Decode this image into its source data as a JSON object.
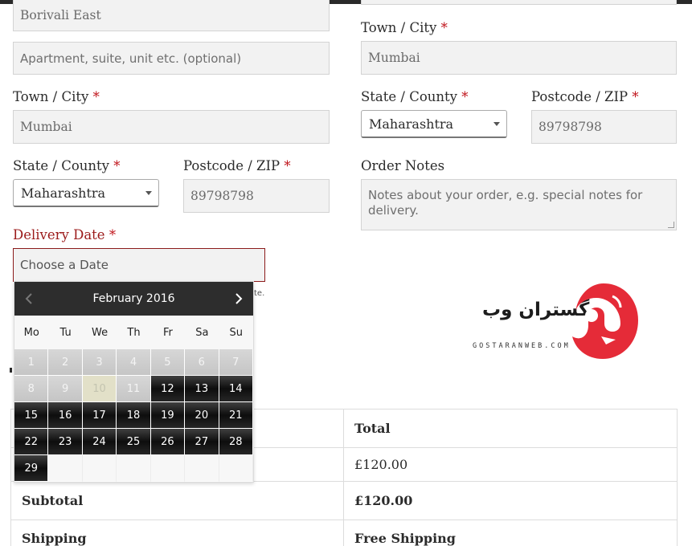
{
  "billing": {
    "address_1": "Borivali East",
    "address_2_placeholder": "Apartment, suite, unit etc. (optional)",
    "city_label": "Town / City",
    "city_value": "Mumbai",
    "state_label": "State / County",
    "state_value": "Maharashtra",
    "postcode_label": "Postcode / ZIP",
    "postcode_value": "89798798",
    "required_mark": "*"
  },
  "shipping": {
    "city_label": "Town / City",
    "city_value": "Mumbai",
    "state_label": "State / County",
    "state_value": "Maharashtra",
    "postcode_label": "Postcode / ZIP",
    "postcode_value": "89798798",
    "order_notes_label": "Order Notes",
    "order_notes_placeholder": "Notes about your order, e.g. special notes for delivery."
  },
  "delivery": {
    "label": "Delivery Date",
    "placeholder": "Choose a Date",
    "hint_fragment": "te."
  },
  "calendar": {
    "month_label": "February 2016",
    "weekdays": [
      "Mo",
      "Tu",
      "We",
      "Th",
      "Fr",
      "Sa",
      "Su"
    ],
    "days": [
      {
        "n": "1",
        "state": "past"
      },
      {
        "n": "2",
        "state": "past"
      },
      {
        "n": "3",
        "state": "past"
      },
      {
        "n": "4",
        "state": "past"
      },
      {
        "n": "5",
        "state": "past"
      },
      {
        "n": "6",
        "state": "past"
      },
      {
        "n": "7",
        "state": "past"
      },
      {
        "n": "8",
        "state": "past"
      },
      {
        "n": "9",
        "state": "past"
      },
      {
        "n": "10",
        "state": "today"
      },
      {
        "n": "11",
        "state": "past"
      },
      {
        "n": "12",
        "state": "avail"
      },
      {
        "n": "13",
        "state": "avail"
      },
      {
        "n": "14",
        "state": "avail"
      },
      {
        "n": "15",
        "state": "avail"
      },
      {
        "n": "16",
        "state": "avail"
      },
      {
        "n": "17",
        "state": "avail"
      },
      {
        "n": "18",
        "state": "avail"
      },
      {
        "n": "19",
        "state": "avail"
      },
      {
        "n": "20",
        "state": "avail"
      },
      {
        "n": "21",
        "state": "avail"
      },
      {
        "n": "22",
        "state": "avail"
      },
      {
        "n": "23",
        "state": "avail"
      },
      {
        "n": "24",
        "state": "avail"
      },
      {
        "n": "25",
        "state": "avail"
      },
      {
        "n": "26",
        "state": "avail"
      },
      {
        "n": "27",
        "state": "avail"
      },
      {
        "n": "28",
        "state": "avail"
      },
      {
        "n": "29",
        "state": "avail"
      },
      {
        "n": "",
        "state": "empty"
      },
      {
        "n": "",
        "state": "empty"
      },
      {
        "n": "",
        "state": "empty"
      },
      {
        "n": "",
        "state": "empty"
      },
      {
        "n": "",
        "state": "empty"
      },
      {
        "n": "",
        "state": "empty"
      }
    ],
    "prev_icon": "chevron-left-icon",
    "next_icon": "chevron-right-icon"
  },
  "order": {
    "total_header": "Total",
    "product_total": "£120.00",
    "subtotal_label": "Subtotal",
    "subtotal_value": "£120.00",
    "shipping_label": "Shipping",
    "shipping_value": "Free Shipping"
  },
  "logo": {
    "text": "گستران وب",
    "domain": "GOSTARANWEB.COM"
  },
  "colors": {
    "required": "#c0141b",
    "delivery_label": "#9b1a1a",
    "logo_red": "#e52b38"
  }
}
